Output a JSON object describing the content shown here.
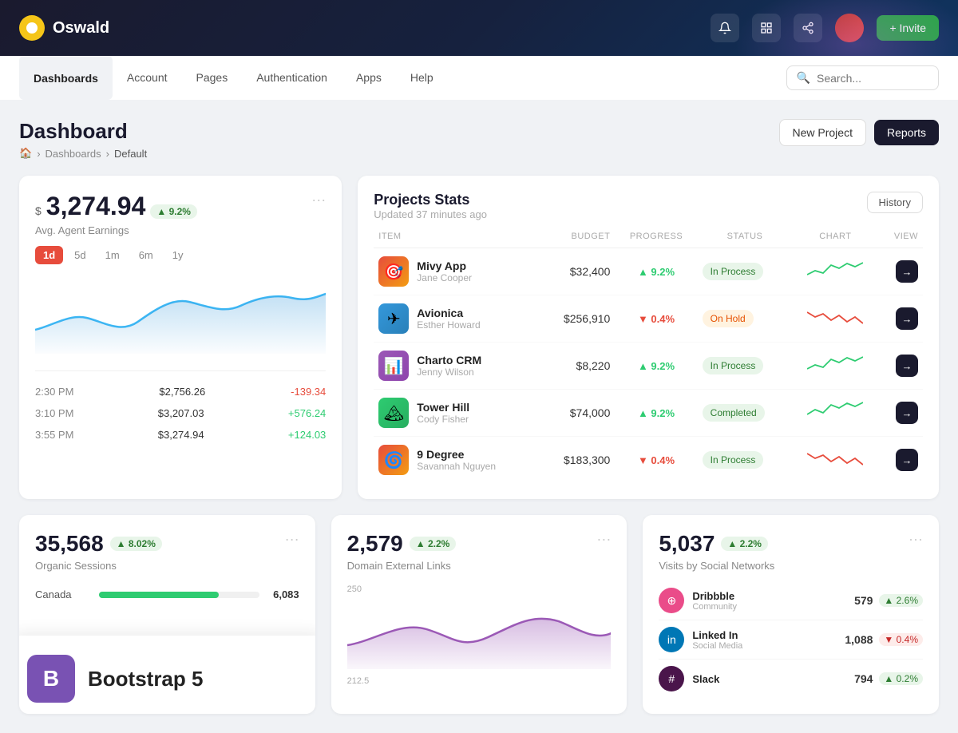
{
  "app": {
    "name": "Oswald",
    "invite_label": "+ Invite"
  },
  "secondary_nav": {
    "tabs": [
      {
        "id": "dashboards",
        "label": "Dashboards",
        "active": true
      },
      {
        "id": "account",
        "label": "Account",
        "active": false
      },
      {
        "id": "pages",
        "label": "Pages",
        "active": false
      },
      {
        "id": "authentication",
        "label": "Authentication",
        "active": false
      },
      {
        "id": "apps",
        "label": "Apps",
        "active": false
      },
      {
        "id": "help",
        "label": "Help",
        "active": false
      }
    ],
    "search_placeholder": "Search..."
  },
  "page_header": {
    "title": "Dashboard",
    "breadcrumb": [
      "home",
      "Dashboards",
      "Default"
    ],
    "new_project_label": "New Project",
    "reports_label": "Reports"
  },
  "earnings_card": {
    "currency_symbol": "$",
    "amount": "3,274.94",
    "badge": "▲ 9.2%",
    "label": "Avg. Agent Earnings",
    "period_tabs": [
      "1d",
      "5d",
      "1m",
      "6m",
      "1y"
    ],
    "active_period": "1d",
    "rows": [
      {
        "time": "2:30 PM",
        "amount": "$2,756.26",
        "change": "-139.34",
        "positive": false
      },
      {
        "time": "3:10 PM",
        "amount": "$3,207.03",
        "change": "+576.24",
        "positive": true
      },
      {
        "time": "3:55 PM",
        "amount": "$3,274.94",
        "change": "+124.03",
        "positive": true
      }
    ]
  },
  "projects_stats": {
    "title": "Projects Stats",
    "subtitle": "Updated 37 minutes ago",
    "history_label": "History",
    "columns": [
      "ITEM",
      "BUDGET",
      "PROGRESS",
      "STATUS",
      "CHART",
      "VIEW"
    ],
    "projects": [
      {
        "id": 1,
        "name": "Mivy App",
        "owner": "Jane Cooper",
        "budget": "$32,400",
        "progress": "▲ 9.2%",
        "progress_up": true,
        "status": "In Process",
        "status_class": "status-inprocess",
        "color": "#e74c3c"
      },
      {
        "id": 2,
        "name": "Avionica",
        "owner": "Esther Howard",
        "budget": "$256,910",
        "progress": "▼ 0.4%",
        "progress_up": false,
        "status": "On Hold",
        "status_class": "status-onhold",
        "color": "#3498db"
      },
      {
        "id": 3,
        "name": "Charto CRM",
        "owner": "Jenny Wilson",
        "budget": "$8,220",
        "progress": "▲ 9.2%",
        "progress_up": true,
        "status": "In Process",
        "status_class": "status-inprocess",
        "color": "#9b59b6"
      },
      {
        "id": 4,
        "name": "Tower Hill",
        "owner": "Cody Fisher",
        "budget": "$74,000",
        "progress": "▲ 9.2%",
        "progress_up": true,
        "status": "Completed",
        "status_class": "status-completed",
        "color": "#2ecc71"
      },
      {
        "id": 5,
        "name": "9 Degree",
        "owner": "Savannah Nguyen",
        "budget": "$183,300",
        "progress": "▼ 0.4%",
        "progress_up": false,
        "status": "In Process",
        "status_class": "status-inprocess",
        "color": "#e74c3c"
      }
    ]
  },
  "organic_sessions": {
    "value": "35,568",
    "badge": "▲ 8.02%",
    "label": "Organic Sessions",
    "dots_label": "..."
  },
  "domain_links": {
    "value": "2,579",
    "badge": "▲ 2.2%",
    "label": "Domain External Links",
    "dots_label": "...",
    "chart_max": 250,
    "chart_mid": 212.5
  },
  "social_networks": {
    "value": "5,037",
    "badge": "▲ 2.2%",
    "label": "Visits by Social Networks",
    "dots_label": "...",
    "networks": [
      {
        "name": "Dribbble",
        "type": "Community",
        "count": "579",
        "change": "▲ 2.6%",
        "up": true,
        "color": "#ea4c89"
      },
      {
        "name": "Linked In",
        "type": "Social Media",
        "count": "1,088",
        "change": "▼ 0.4%",
        "up": false,
        "color": "#0077b5"
      },
      {
        "name": "Slack",
        "type": "",
        "count": "794",
        "change": "▲ 0.2%",
        "up": true,
        "color": "#4a154b"
      }
    ]
  },
  "map_card": {
    "rows": [
      {
        "label": "Canada",
        "value": "6,083",
        "pct": 75
      }
    ]
  },
  "bootstrap": {
    "logo_letter": "B",
    "text": "Bootstrap 5"
  }
}
